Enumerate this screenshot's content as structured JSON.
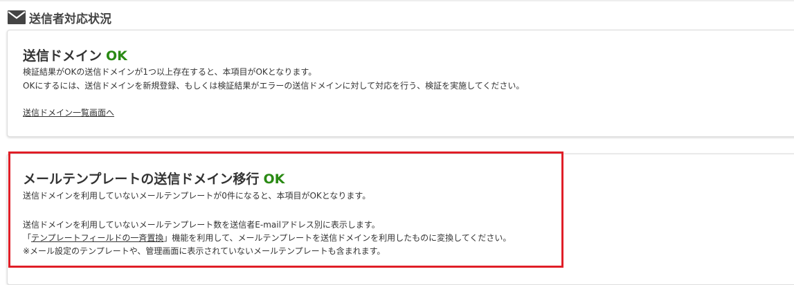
{
  "header": {
    "icon": "mail-icon",
    "title": "送信者対応状況"
  },
  "domain_card": {
    "title": "送信ドメイン",
    "status": "OK",
    "status_color": "#2a8a14",
    "desc_line1": "検証結果がOKの送信ドメインが1つ以上存在すると、本項目がOKとなります。",
    "desc_line2": "OKにするには、送信ドメインを新規登録、もしくは検証結果がエラーの送信ドメインに対して対応を行う、検証を実施してください。",
    "link": "送信ドメイン一覧画面へ"
  },
  "template_card": {
    "title": "メールテンプレートの送信ドメイン移行",
    "status": "OK",
    "status_color": "#2a8a14",
    "desc_line1": "送信ドメインを利用していないメールテンプレートが0件になると、本項目がOKとなります。",
    "desc_line2": "送信ドメインを利用していないメールテンプレート数を送信者E-mailアドレス別に表示します。",
    "desc_line3_prefix": "「",
    "desc_line3_link": "テンプレートフィールドの一斉置換",
    "desc_line3_suffix": "」機能を利用して、メールテンプレートを送信ドメインを利用したものに変換してください。",
    "desc_line4": "※メール設定のテンプレートや、管理画面に表示されていないメールテンプレートも含まれます。"
  },
  "highlight_color": "#e01e27"
}
